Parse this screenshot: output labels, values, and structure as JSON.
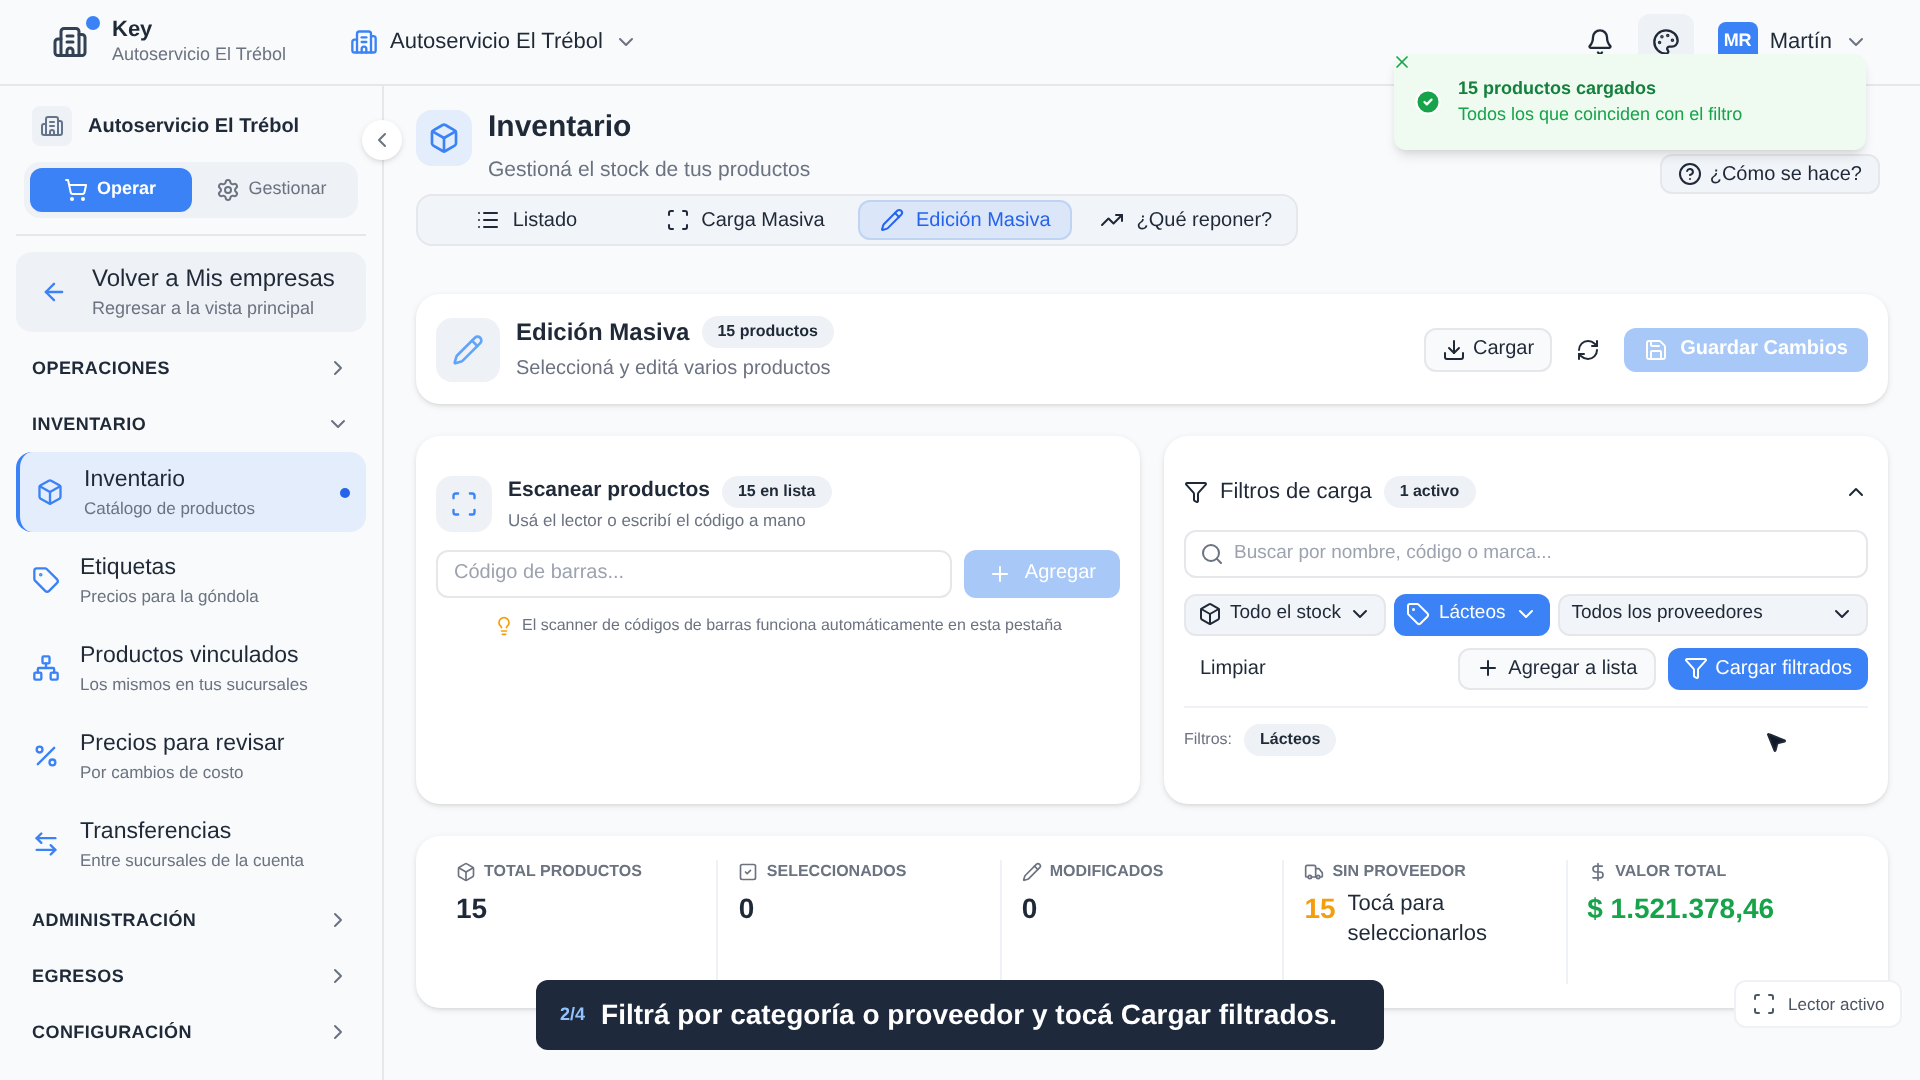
{
  "header": {
    "app_name": "Key",
    "business": "Autoservicio El Trébol",
    "selector": "Autoservicio El Trébol",
    "notification_dot": true,
    "user": {
      "initials": "MR",
      "name": "Martín"
    }
  },
  "sidebar": {
    "business": "Autoservicio El Trébol",
    "modes": [
      {
        "label": "Operar",
        "selected": true
      },
      {
        "label": "Gestionar",
        "selected": false
      }
    ],
    "back": {
      "title": "Volver a Mis empresas",
      "subtitle": "Regresar a la vista principal"
    },
    "sections": [
      {
        "label": "OPERACIONES",
        "expanded": false
      },
      {
        "label": "INVENTARIO",
        "expanded": true,
        "items": [
          {
            "title": "Inventario",
            "subtitle": "Catálogo de productos",
            "selected": true
          },
          {
            "title": "Etiquetas",
            "subtitle": "Precios para la góndola",
            "selected": false
          },
          {
            "title": "Productos vinculados",
            "subtitle": "Los mismos en tus sucursales",
            "selected": false
          },
          {
            "title": "Precios para revisar",
            "subtitle": "Por cambios de costo",
            "selected": false
          },
          {
            "title": "Transferencias",
            "subtitle": "Entre sucursales de la cuenta",
            "selected": false
          }
        ]
      },
      {
        "label": "ADMINISTRACIÓN",
        "expanded": false
      },
      {
        "label": "EGRESOS",
        "expanded": false
      },
      {
        "label": "CONFIGURACIÓN",
        "expanded": false
      }
    ]
  },
  "page": {
    "title": "Inventario",
    "subtitle": "Gestioná el stock de tus productos",
    "help_button": "¿Cómo se hace?",
    "tabs": [
      {
        "label": "Listado",
        "selected": false
      },
      {
        "label": "Carga Masiva",
        "selected": false
      },
      {
        "label": "Edición Masiva",
        "selected": true
      },
      {
        "label": "¿Qué reponer?",
        "selected": false
      }
    ]
  },
  "edit_card": {
    "title": "Edición Masiva",
    "badge": "15 productos",
    "subtitle": "Seleccioná y editá varios productos",
    "load_button": "Cargar",
    "save_button": {
      "label": "Guardar Cambios",
      "disabled": true
    }
  },
  "scan_card": {
    "title": "Escanear productos",
    "badge": "15 en lista",
    "subtitle": "Usá el lector o escribí el código a mano",
    "input": {
      "placeholder": "Código de barras..."
    },
    "add_button": {
      "label": "Agregar",
      "disabled": true
    },
    "hint": "El scanner de códigos de barras funciona automáticamente en esta pestaña"
  },
  "filter_card": {
    "title": "Filtros de carga",
    "badge": "1 activo",
    "expanded": true,
    "search": {
      "placeholder": "Buscar por nombre, código o marca..."
    },
    "dropdowns": [
      {
        "label": "Todo el stock",
        "selected": false
      },
      {
        "label": "Lácteos",
        "selected": true
      },
      {
        "label": "Todos los proveedores",
        "selected": false
      }
    ],
    "clear_button": "Limpiar",
    "add_to_list_button": "Agregar a lista",
    "load_filtered_button": "Cargar filtrados",
    "active_label": "Filtros:",
    "chips": [
      "Lácteos"
    ]
  },
  "stats": [
    {
      "label": "TOTAL PRODUCTOS",
      "value": "15",
      "color": "#1f2937"
    },
    {
      "label": "SELECCIONADOS",
      "value": "0",
      "color": "#1f2937"
    },
    {
      "label": "MODIFICADOS",
      "value": "0",
      "color": "#1f2937"
    },
    {
      "label": "SIN PROVEEDOR",
      "value": "15",
      "note": "Tocá para seleccionarlos",
      "color": "#f59e0b"
    },
    {
      "label": "VALOR TOTAL",
      "value": "$ 1.521.378,46",
      "color": "#16a34a"
    }
  ],
  "reader_badge": "Lector activo",
  "toast": {
    "title": "15 productos cargados",
    "message": "Todos los que coinciden con el filtro"
  },
  "tour": {
    "step": "2/4",
    "text": "Filtrá por categoría o proveedor y tocá Cargar filtrados."
  }
}
